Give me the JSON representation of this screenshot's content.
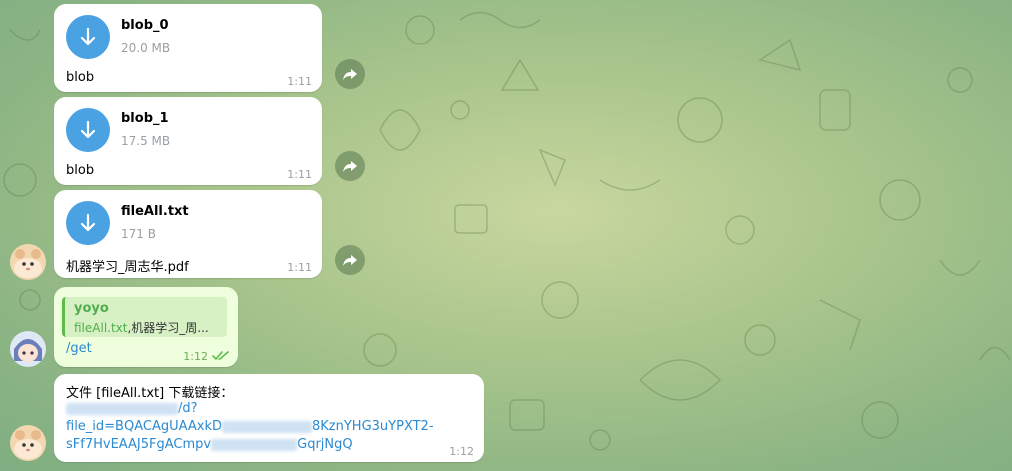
{
  "messages": [
    {
      "name": "blob_0",
      "size": "20.0 MB",
      "caption": "blob",
      "time": "1:11"
    },
    {
      "name": "blob_1",
      "size": "17.5 MB",
      "caption": "blob",
      "time": "1:11"
    },
    {
      "name": "fileAll.txt",
      "size": "171 B",
      "caption": "机器学习_周志华.pdf",
      "time": "1:11"
    }
  ],
  "outgoing": {
    "reply_name": "yoyo",
    "reply_file": "fileAll.txt",
    "reply_rest": ",机器学习_周...",
    "text": "/get",
    "time": "1:12"
  },
  "bot_reply": {
    "line1": "文件 [fileAll.txt] 下载链接：",
    "line2_suffix": "/d?",
    "line3_prefix": "file_id=BQACAgUAAxkD",
    "line3_suffix": "8KznYHG3uYPXT2-",
    "line4_prefix": "sFf7HvEAAJ5FgACmpv",
    "line4_suffix": "GqrjNgQ",
    "time": "1:12"
  },
  "colors": {
    "accent": "#4aa2e3",
    "outgoing_bg": "#effedd",
    "reply_accent": "#4fae4e",
    "link": "#2a8ad1"
  }
}
